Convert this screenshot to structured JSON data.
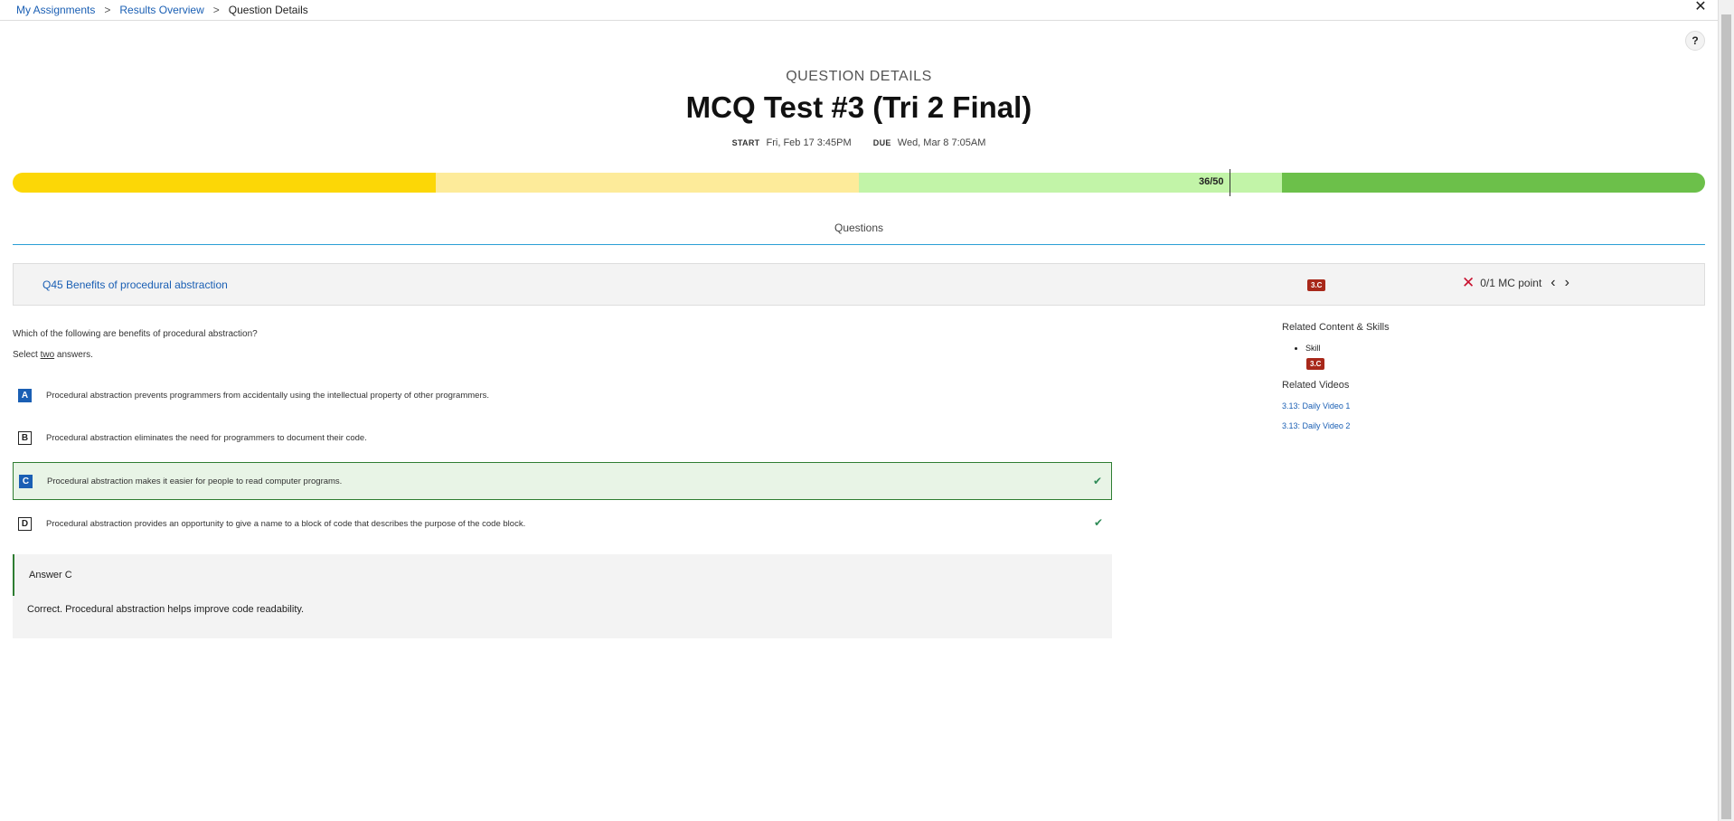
{
  "breadcrumb": {
    "items": [
      "My Assignments",
      "Results Overview"
    ],
    "current": "Question Details",
    "separator": ">"
  },
  "header": {
    "eyebrow": "QUESTION DETAILS",
    "title": "MCQ Test #3 (Tri 2 Final)",
    "start_label": "START",
    "start_value": "Fri, Feb 17 3:45PM",
    "due_label": "DUE",
    "due_value": "Wed, Mar 8 7:05AM",
    "help": "?",
    "close": "✕"
  },
  "progress": {
    "score_label": "36/50",
    "score": 36,
    "total": 50,
    "colors": [
      "#fcd706",
      "#fdeb9a",
      "#c2f4a8",
      "#6cc04a"
    ]
  },
  "tabs": {
    "questions": "Questions"
  },
  "question": {
    "title": "Q45 Benefits of procedural abstraction",
    "badge": "3.C",
    "score": "0/1 MC point",
    "prev": "‹",
    "next": "›",
    "prompt": "Which of the following are benefits of procedural abstraction?",
    "instruction_prefix": "Select ",
    "instruction_emph": "two",
    "instruction_suffix": " answers."
  },
  "options": [
    {
      "letter": "A",
      "text": "Procedural abstraction prevents programmers from accidentally using the intellectual property of other programmers.",
      "selected": true,
      "correct": false
    },
    {
      "letter": "B",
      "text": "Procedural abstraction eliminates the need for programmers to document their code.",
      "selected": false,
      "correct": false
    },
    {
      "letter": "C",
      "text": "Procedural abstraction makes it easier for people to read computer programs.",
      "selected": true,
      "correct": true
    },
    {
      "letter": "D",
      "text": "Procedural abstraction provides an opportunity to give a name to a block of code that describes the purpose of the code block.",
      "selected": false,
      "correct": true
    }
  ],
  "answer": {
    "heading": "Answer C",
    "explanation": "Correct. Procedural abstraction helps improve code readability."
  },
  "sidebar": {
    "related_heading": "Related Content & Skills",
    "skill_label": "Skill",
    "skill_badge": "3.C",
    "videos_heading": "Related Videos",
    "videos": [
      "3.13: Daily Video 1",
      "3.13: Daily Video 2"
    ]
  }
}
